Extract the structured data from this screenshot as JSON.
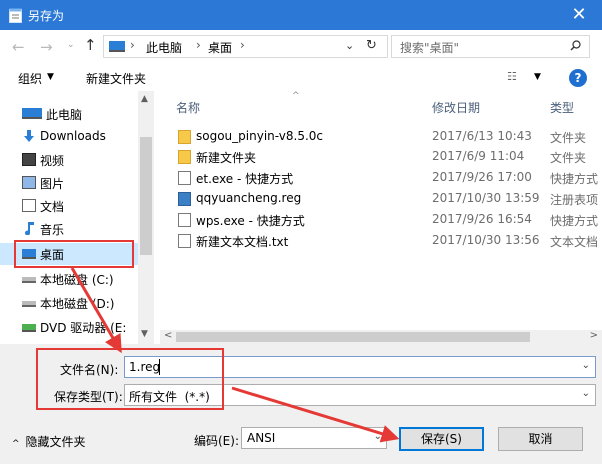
{
  "window": {
    "title": "另存为",
    "close_glyph": "✕"
  },
  "nav": {
    "back_glyph": "←",
    "forward_glyph": "→",
    "recent_glyph": "⌄",
    "up_glyph": "↑",
    "address_parts": [
      "此电脑",
      "桌面"
    ],
    "address_sep": "›",
    "dropdown_glyph": "⌄",
    "refresh_glyph": "↻",
    "search_placeholder": "搜索\"桌面\""
  },
  "toolbar": {
    "organize": "组织",
    "organize_arrow": "▼",
    "new_folder": "新建文件夹",
    "view_glyph": "☷",
    "view_arrow": "▼",
    "help": "?"
  },
  "sidebar": {
    "items": [
      {
        "label": "此电脑",
        "icon": "computer-icon"
      },
      {
        "label": "Downloads",
        "icon": "download-icon"
      },
      {
        "label": "视频",
        "icon": "video-icon"
      },
      {
        "label": "图片",
        "icon": "picture-icon"
      },
      {
        "label": "文档",
        "icon": "document-icon"
      },
      {
        "label": "音乐",
        "icon": "music-icon"
      },
      {
        "label": "桌面",
        "icon": "desktop-icon",
        "selected": true
      },
      {
        "label": "本地磁盘 (C:)",
        "icon": "drive-icon"
      },
      {
        "label": "本地磁盘 (D:)",
        "icon": "drive-icon"
      },
      {
        "label": "DVD 驱动器 (E:",
        "icon": "dvd-icon"
      }
    ],
    "scroll_up": "▲",
    "scroll_down": "▼"
  },
  "files": {
    "columns": {
      "name": "名称",
      "date": "修改日期",
      "type": "类型"
    },
    "sort_glyph": "^",
    "rows": [
      {
        "name": "sogou_pinyin-v8.5.0c",
        "date": "2017/6/13 10:43",
        "type": "文件夹",
        "icon": "folder-icon"
      },
      {
        "name": "新建文件夹",
        "date": "2017/6/9 11:04",
        "type": "文件夹",
        "icon": "folder-icon"
      },
      {
        "name": "et.exe - 快捷方式",
        "date": "2017/9/26 17:00",
        "type": "快捷方式",
        "icon": "shortcut-icon"
      },
      {
        "name": "qqyuancheng.reg",
        "date": "2017/10/30 13:59",
        "type": "注册表项",
        "icon": "registry-icon"
      },
      {
        "name": "wps.exe - 快捷方式",
        "date": "2017/9/26 16:54",
        "type": "快捷方式",
        "icon": "shortcut-icon"
      },
      {
        "name": "新建文本文档.txt",
        "date": "2017/10/30 13:56",
        "type": "文本文档",
        "icon": "text-file-icon"
      }
    ],
    "hscroll_left": "<",
    "hscroll_right": ">"
  },
  "form": {
    "filename_label": "文件名(N):",
    "filename_value": "1.reg",
    "filetype_label": "保存类型(T):",
    "filetype_value": "所有文件  (*.*)",
    "dropdown_glyph": "⌄",
    "encoding_label": "编码(E):",
    "encoding_value": "ANSI",
    "hide_folders": "隐藏文件夹",
    "hide_folders_glyph": "^",
    "save_button": "保存(S)",
    "cancel_button": "取消"
  },
  "colors": {
    "titlebar": "#2b78d6",
    "selection": "#cce8ff",
    "annotation": "#e53935",
    "accent": "#0078d7"
  }
}
